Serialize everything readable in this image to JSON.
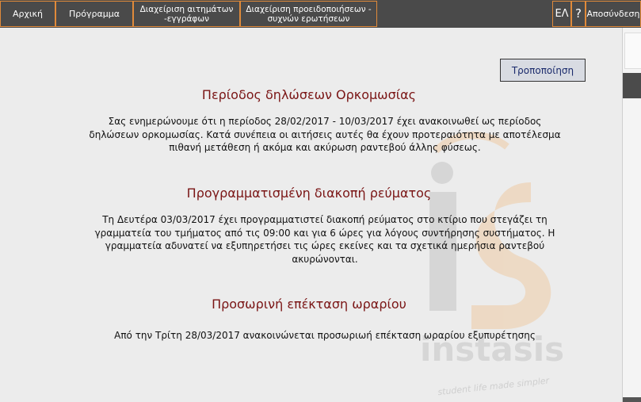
{
  "nav": {
    "home": "Αρχική",
    "schedule": "Πρόγραμμα",
    "requests": "Διαχείριση αιτημάτων -εγγράφων",
    "notices": "Διαχείριση προειδοποιήσεων - συχνών ερωτήσεων",
    "language": "ΕΛ",
    "help": "?",
    "logout": "Αποσύνδεση"
  },
  "edit_button": "Τροποποίηση",
  "announcements": [
    {
      "title": "Περίοδος δηλώσεων Ορκομωσίας",
      "body": "Σας ενημερώνουμε ότι η περίοδος 28/02/2017 - 10/03/2017 έχει ανακοινωθεί ως περίοδος δηλώσεων ορκομωσίας. Κατά συνέπεια οι αιτήσεις αυτές θα έχουν προτεραιότητα με αποτέλεσμα πιθανή μετάθεση ή ακόμα και ακύρωση ραντεβού άλλης φύσεως."
    },
    {
      "title": "Προγραμματισμένη διακοπή ρεύματος",
      "body": "Τη Δευτέρα 03/03/2017 έχει προγραμματιστεί διακοπή ρεύματος στο κτίριο που στεγάζει τη γραμματεία του τμήματος από τις 09:00 και για 6 ώρες για λόγους συντήρησης συστήματος. Η γραμματεία αδυνατεί να εξυπηρετήσει τις ώρες εκείνες και τα σχετικά ημερήσια ραντεβού ακυρώνονται."
    },
    {
      "title": "Προσωρινή επέκταση ωραρίου",
      "body": "Από την Τρίτη 28/03/2017 ανακοινώνεται προσωριωή επέκταση ωραρίου εξυπυρέτησης"
    }
  ],
  "watermark": {
    "logo_text": "instasis",
    "tagline": "student life made simpler"
  },
  "colors": {
    "topbar": "#4a4a4a",
    "nav_border": "#e08a3a",
    "title": "#7a1515",
    "background": "#ececec"
  }
}
